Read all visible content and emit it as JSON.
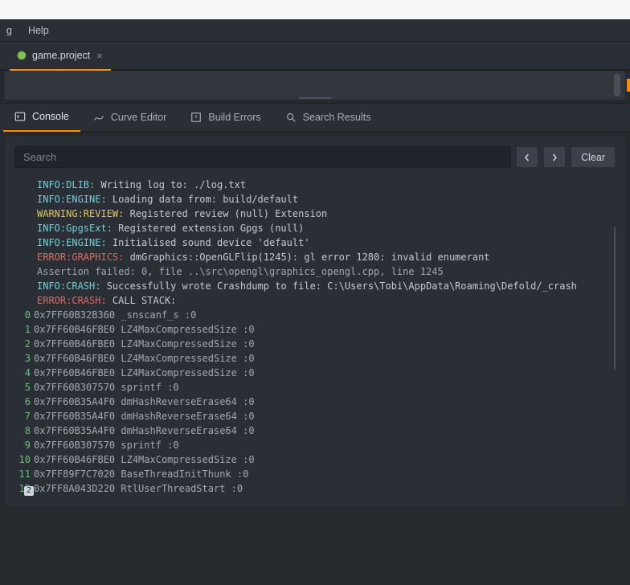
{
  "menu": {
    "item0": "g",
    "item1": "Help"
  },
  "editor_tab": {
    "label": "game.project"
  },
  "panel_tabs": {
    "console": "Console",
    "curve": "Curve Editor",
    "build": "Build Errors",
    "search": "Search Results"
  },
  "toolbar": {
    "search_placeholder": "Search",
    "clear": "Clear"
  },
  "badge": "2",
  "log": {
    "l0_pre": "INFO:DLIB:",
    "l0_body": " Writing log to: ./log.txt",
    "l1_pre": "INFO:ENGINE:",
    "l1_body": " Loading data from: build/default",
    "l2_pre": "WARNING:REVIEW:",
    "l2_body": " Registered review (null) Extension",
    "blank1": "",
    "l3_pre": "INFO:GpgsExt:",
    "l3_body": " Registered extension Gpgs (null)",
    "l4_pre": "INFO:ENGINE:",
    "l4_body": " Initialised sound device 'default'",
    "l5_pre": "ERROR:GRAPHICS:",
    "l5_body": " dmGraphics::OpenGLFlip(1245): gl error 1280: invalid enumerant",
    "blank2": "",
    "l6": "Assertion failed: 0, file ..\\src\\opengl\\graphics_opengl.cpp, line 1245",
    "l7_pre": "INFO:CRASH:",
    "l7_body": " Successfully wrote Crashdump to file: C:\\Users\\Tobi\\AppData\\Roaming\\Defold/_crash",
    "l8_pre": "ERROR:CRASH:",
    "l8_body": " CALL STACK:",
    "blank3": "",
    "stack": [
      {
        "n": "0",
        "t": "0x7FF60B32B360 _snscanf_s <unknown>:0"
      },
      {
        "n": "1",
        "t": "0x7FF60B46FBE0 LZ4MaxCompressedSize <unknown>:0"
      },
      {
        "n": "2",
        "t": "0x7FF60B46FBE0 LZ4MaxCompressedSize <unknown>:0"
      },
      {
        "n": "3",
        "t": "0x7FF60B46FBE0 LZ4MaxCompressedSize <unknown>:0"
      },
      {
        "n": "4",
        "t": "0x7FF60B46FBE0 LZ4MaxCompressedSize <unknown>:0"
      },
      {
        "n": "5",
        "t": "0x7FF60B307570 sprintf <unknown>:0"
      },
      {
        "n": "6",
        "t": "0x7FF60B35A4F0 dmHashReverseErase64 <unknown>:0"
      },
      {
        "n": "7",
        "t": "0x7FF60B35A4F0 dmHashReverseErase64 <unknown>:0"
      },
      {
        "n": "8",
        "t": "0x7FF60B35A4F0 dmHashReverseErase64 <unknown>:0"
      },
      {
        "n": "9",
        "t": "0x7FF60B307570 sprintf <unknown>:0"
      },
      {
        "n": "10",
        "t": "0x7FF60B46FBE0 LZ4MaxCompressedSize <unknown>:0"
      },
      {
        "n": "11",
        "t": "0x7FF89F7C7020 BaseThreadInitThunk <unknown>:0"
      },
      {
        "n": "12",
        "t": "0x7FF8A043D220 RtlUserThreadStart <unknown>:0"
      }
    ]
  }
}
